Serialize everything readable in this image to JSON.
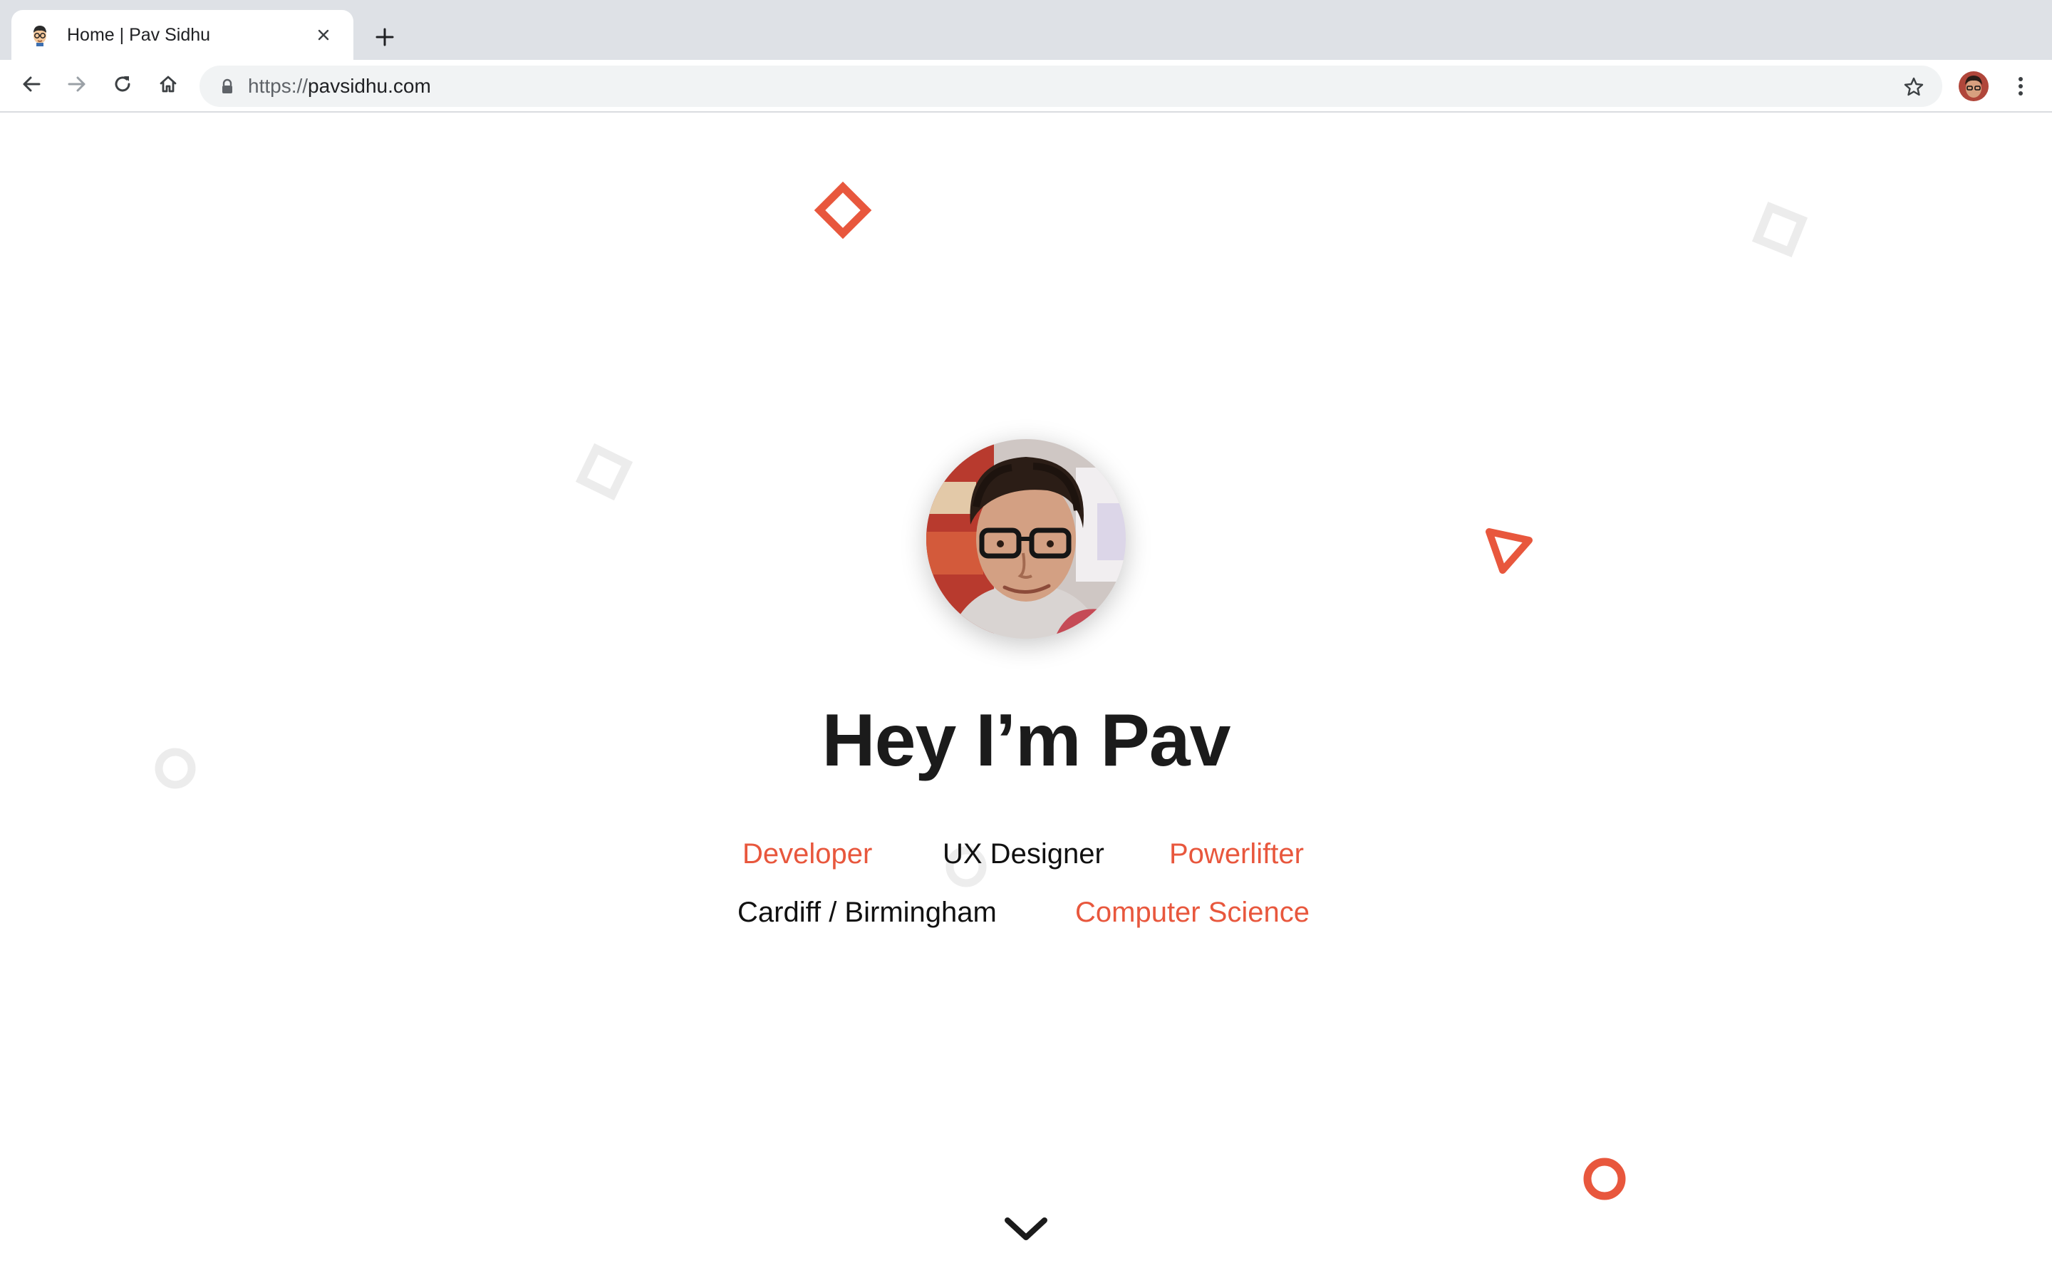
{
  "browser": {
    "tab": {
      "title": "Home | Pav Sidhu"
    },
    "address_bar": {
      "scheme": "https://",
      "host": "pavsidhu.com"
    },
    "icons": {
      "favicon": "avatar-cartoon-icon",
      "close": "close-icon",
      "new_tab": "plus-icon",
      "back": "arrow-left-icon",
      "forward": "arrow-right-icon",
      "reload": "reload-icon",
      "home": "home-icon",
      "lock": "lock-icon",
      "bookmark": "star-icon",
      "menu": "kebab-menu-icon"
    }
  },
  "hero": {
    "headline": "Hey I’m Pav",
    "roles": {
      "developer": "Developer",
      "ux_designer": "UX Designer",
      "powerlifter": "Powerlifter",
      "location": "Cardiff / Birmingham",
      "computer_science": "Computer Science"
    },
    "scroll_icon": "chevron-down-icon"
  },
  "colors": {
    "accent": "#e8573d",
    "headline": "#1b1b1b",
    "shape_muted": "#ececec",
    "chrome_tabstrip": "#dee1e6",
    "omnibox": "#f1f3f4"
  }
}
